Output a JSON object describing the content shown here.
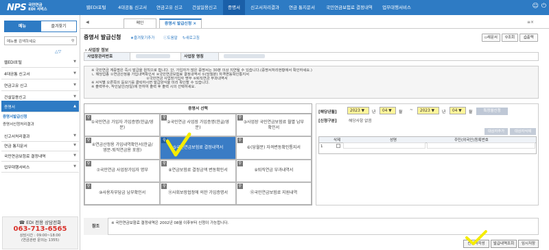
{
  "header": {
    "logo_mark": "NPS",
    "logo_line1": "국민연금",
    "logo_line2": "EDI 서비스",
    "nav": [
      "웹EDI포털",
      "4대공통 신고서",
      "연금고유 신고",
      "건설일용신고",
      "증명서",
      "신고서처리결과",
      "연금 통지문서",
      "국민연금보험료 결정내역",
      "업무대행서비스"
    ],
    "active_nav": 4,
    "right_icons": [
      "user-icon",
      "power-icon"
    ]
  },
  "sidebar": {
    "tab_menu": "메뉴",
    "tab_fav": "즐겨찾기",
    "search_placeholder": "메뉴를 검색하세요",
    "items": [
      "웹EDI포털",
      "4대공통 신고서",
      "연금고유 신고",
      "건설일용신고",
      "증명서",
      "신고서처리결과",
      "연금 통지문서",
      "국민연금보험료 결정내역",
      "업무대행서비스"
    ],
    "open_index": 4,
    "sub_items": [
      "증명서발급신청",
      "증명서신청처리결과"
    ],
    "sub_current": 0
  },
  "help": {
    "title": "EDI 전용 상담전화",
    "phone": "063-713-6565",
    "hours": "상담시간 : 09:00~18:00",
    "note": "(연금관련 문의는 1355)"
  },
  "tabs": {
    "items": [
      "메인",
      "증명서 발급신청"
    ],
    "active": 1
  },
  "page": {
    "title": "증명서 발급신청",
    "link_fav": "즐겨찾기추가",
    "link_help": "도움말",
    "link_refresh": "새로고침",
    "btn_new": "새문서",
    "btn_query": "조회",
    "btn_print": "출력"
  },
  "biz": {
    "section": "사업장 정보",
    "no_label": "사업장관리번호",
    "name_label": "사업장 명칭"
  },
  "notice": [
    "※ 국민연금 계증명은 즉시 발급을 원칙으로 합니다. 단, 가입자가 많은 증명서는 30분 이상 지연될 수 있습니다.(증명서처리현황에서 확인하세요.)",
    "   ㄴ 해당업종   ①연금산정용 가입내역확인서       ④국민연금보험료 결정내역서       ⑤(당월분) 자격변동확인통지서",
    "   ②국민연금 사업장가입자 명부       ⑥퇴직연금 부과내역서",
    "※ 서식별 오른쪽의 돋보기를 클릭하시면 발급양식을 미리 확인할 수 있습니다.",
    "※ 출력부수, 작인날인(당일)에 한하여 출력 후 출력 시의 선택하세요."
  ],
  "cert": {
    "title": "증명서 선택",
    "cells": [
      "①국민연금 가입자 가입증명(한글/영문)",
      "②국민연금 사업장 가입증명(한글/영문)",
      "③사업장 국민연금보험료 월별 납부확인서",
      "④연금산정용 가입내역확인서(한글/영문-퇴직연금용 포함)",
      "⑤국민연금보험료 결정내역서",
      "⑥(당월분) 자격변동확인통지서",
      "⑦국민연금 사업장가입자 명부",
      "⑧연금보험료 결정금액 변동확인서",
      "⑨퇴직연금 부과내역서",
      "⑩사용자부담금 납부확인서",
      "⑪사회보장협정에 의한 가입증명서",
      "⑫국민연금보험료 지원내역"
    ],
    "selected": 4
  },
  "period": {
    "label": "[해당년월]",
    "from_year": "2023",
    "from_month": "04",
    "to_year": "2023",
    "to_month": "04",
    "unit_year": "년",
    "unit_month": "월",
    "sep": "~",
    "btn_search": "특정월신청",
    "bizcat_label": "[신청구분]",
    "bizcat_value": "해당사항 없음",
    "btn_add": "대상자추가",
    "btn_del": "대상자삭제"
  },
  "person_table": {
    "columns": [
      "삭제",
      "성명",
      "주민(외국인)등록번호"
    ],
    "rows": [
      {
        "no": "1"
      }
    ]
  },
  "remark": {
    "label": "참조",
    "text": "※ 국민연금보험료 결정내역은 2002년 08월 이후부터 신청이 가능합니다."
  },
  "actions": {
    "apply": "신청서작성",
    "history": "발급내역조회",
    "save": "임시저장"
  },
  "colors": {
    "accent": "#2e7bc4",
    "highlight": "#fff59a",
    "annotation": "#f5ec00"
  }
}
